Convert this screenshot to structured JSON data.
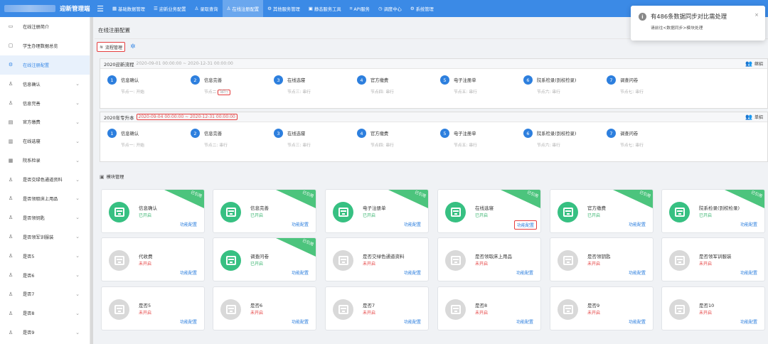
{
  "app": {
    "title": "迎新管理端"
  },
  "nav": [
    {
      "label": "基础数据管理",
      "icon": "grid-icon"
    },
    {
      "label": "迎新业务配置",
      "icon": "list-icon"
    },
    {
      "label": "录取查询",
      "icon": "person-icon"
    },
    {
      "label": "在线注册配置",
      "icon": "person-icon",
      "active": true
    },
    {
      "label": "其他服务管理",
      "icon": "gear-icon"
    },
    {
      "label": "静态服务工具",
      "icon": "image-icon"
    },
    {
      "label": "API服务",
      "icon": "code-icon"
    },
    {
      "label": "调度中心",
      "icon": "schedule-icon"
    },
    {
      "label": "系统管理",
      "icon": "gear-icon"
    }
  ],
  "sidebar": {
    "items": [
      {
        "label": "在线注册简介",
        "icon": "card-icon",
        "chevron": false
      },
      {
        "label": "学生办理数据总览",
        "icon": "monitor-icon",
        "chevron": false
      },
      {
        "label": "在线注册配置",
        "icon": "gear-icon",
        "chevron": false,
        "active": true
      },
      {
        "label": "信息确认",
        "icon": "person-icon",
        "chevron": true
      },
      {
        "label": "信息完善",
        "icon": "person-icon",
        "chevron": true
      },
      {
        "label": "官方缴费",
        "icon": "receipt-icon",
        "chevron": true
      },
      {
        "label": "在线选寝",
        "icon": "bed-icon",
        "chevron": true
      },
      {
        "label": "院系检录",
        "icon": "grid-icon",
        "chevron": true
      },
      {
        "label": "是否交绿色通道资料",
        "icon": "person-icon",
        "chevron": true
      },
      {
        "label": "是否领取床上用品",
        "icon": "person-icon",
        "chevron": true
      },
      {
        "label": "是否领钥匙",
        "icon": "person-icon",
        "chevron": true
      },
      {
        "label": "是否领军训服装",
        "icon": "person-icon",
        "chevron": true
      },
      {
        "label": "是否5",
        "icon": "person-icon",
        "chevron": true
      },
      {
        "label": "是否6",
        "icon": "person-icon",
        "chevron": true
      },
      {
        "label": "是否7",
        "icon": "person-icon",
        "chevron": true
      },
      {
        "label": "是否8",
        "icon": "person-icon",
        "chevron": true
      },
      {
        "label": "是否9",
        "icon": "person-icon",
        "chevron": true
      }
    ]
  },
  "page": {
    "title": "在线注册配置",
    "flow_button": "流程管理",
    "module_title": "模块管理"
  },
  "flows": [
    {
      "name": "2020迎新流程",
      "dates": "2020-09-01 00:00:00 ~ 2020-12-31 00:00:00",
      "mode": "继招",
      "steps": [
        {
          "num": "1",
          "name": "信息确认",
          "node": "节点一:",
          "type": "开始"
        },
        {
          "num": "2",
          "name": "信息完善",
          "node": "节点二:",
          "type": "串行"
        },
        {
          "num": "3",
          "name": "在线选寝",
          "node": "节点三:",
          "type": "串行"
        },
        {
          "num": "4",
          "name": "官方缴费",
          "node": "节点四:",
          "type": "串行"
        },
        {
          "num": "5",
          "name": "电子注册单",
          "node": "节点五:",
          "type": "串行"
        },
        {
          "num": "6",
          "name": "院系检录(到校检录)",
          "node": "节点六:",
          "type": "串行"
        },
        {
          "num": "7",
          "name": "调查问卷",
          "node": "节点七:",
          "type": "串行"
        }
      ]
    },
    {
      "name": "2020年专升本",
      "dates": "2020-09-04 00:00:00 ~ 2020-12-31 00:00:00",
      "mode": "单招",
      "steps": [
        {
          "num": "1",
          "name": "信息确认",
          "node": "节点一:",
          "type": "开始"
        },
        {
          "num": "2",
          "name": "信息完善",
          "node": "节点二:",
          "type": "串行"
        },
        {
          "num": "3",
          "name": "在线选寝",
          "node": "节点三:",
          "type": "串行"
        },
        {
          "num": "4",
          "name": "官方缴费",
          "node": "节点四:",
          "type": "串行"
        },
        {
          "num": "5",
          "name": "电子注册单",
          "node": "节点五:",
          "type": "串行"
        },
        {
          "num": "6",
          "name": "院系检录(到校检录)",
          "node": "节点六:",
          "type": "串行"
        },
        {
          "num": "7",
          "name": "调查问卷",
          "node": "节点七:",
          "type": "串行"
        }
      ]
    }
  ],
  "modules": [
    {
      "name": "信息确认",
      "status": "已开启",
      "on": true,
      "ribbon": "已引用",
      "config": "功能配置"
    },
    {
      "name": "信息完善",
      "status": "已开启",
      "on": true,
      "ribbon": "已引用",
      "config": "功能配置"
    },
    {
      "name": "电子注册单",
      "status": "已开启",
      "on": true,
      "ribbon": "已引用",
      "config": "功能配置"
    },
    {
      "name": "在线选寝",
      "status": "已开启",
      "on": true,
      "ribbon": "已引用",
      "config": "功能配置"
    },
    {
      "name": "官方缴费",
      "status": "已开启",
      "on": true,
      "ribbon": "已引用",
      "config": "功能配置"
    },
    {
      "name": "院系检录(到校检录)",
      "status": "已开启",
      "on": true,
      "ribbon": "已引用",
      "config": "功能配置"
    },
    {
      "name": "代收费",
      "status": "未开启",
      "on": false,
      "ribbon": "",
      "config": "功能配置"
    },
    {
      "name": "调查问卷",
      "status": "已开启",
      "on": true,
      "ribbon": "已引用",
      "config": "功能配置"
    },
    {
      "name": "是否交绿色通道资料",
      "status": "未开启",
      "on": false,
      "ribbon": "",
      "config": "功能配置"
    },
    {
      "name": "是否领取床上用品",
      "status": "未开启",
      "on": false,
      "ribbon": "",
      "config": "功能配置"
    },
    {
      "name": "是否领钥匙",
      "status": "未开启",
      "on": false,
      "ribbon": "",
      "config": "功能配置"
    },
    {
      "name": "是否领军训服装",
      "status": "未开启",
      "on": false,
      "ribbon": "",
      "config": "功能配置"
    },
    {
      "name": "是否5",
      "status": "未开启",
      "on": false,
      "ribbon": "",
      "config": "功能配置"
    },
    {
      "name": "是否6",
      "status": "未开启",
      "on": false,
      "ribbon": "",
      "config": "功能配置"
    },
    {
      "name": "是否7",
      "status": "未开启",
      "on": false,
      "ribbon": "",
      "config": "功能配置"
    },
    {
      "name": "是否8",
      "status": "未开启",
      "on": false,
      "ribbon": "",
      "config": "功能配置"
    },
    {
      "name": "是否9",
      "status": "未开启",
      "on": false,
      "ribbon": "",
      "config": "功能配置"
    },
    {
      "name": "是否10",
      "status": "未开启",
      "on": false,
      "ribbon": "",
      "config": "功能配置"
    }
  ],
  "toast": {
    "title": "有486条数据同步对比需处理",
    "message": "请前往<数据同步>模块处理"
  },
  "colors": {
    "primary": "#3b8ae6",
    "enabled": "#37c082",
    "disabled": "#e53e3e",
    "highlight": "#e53e3e"
  }
}
